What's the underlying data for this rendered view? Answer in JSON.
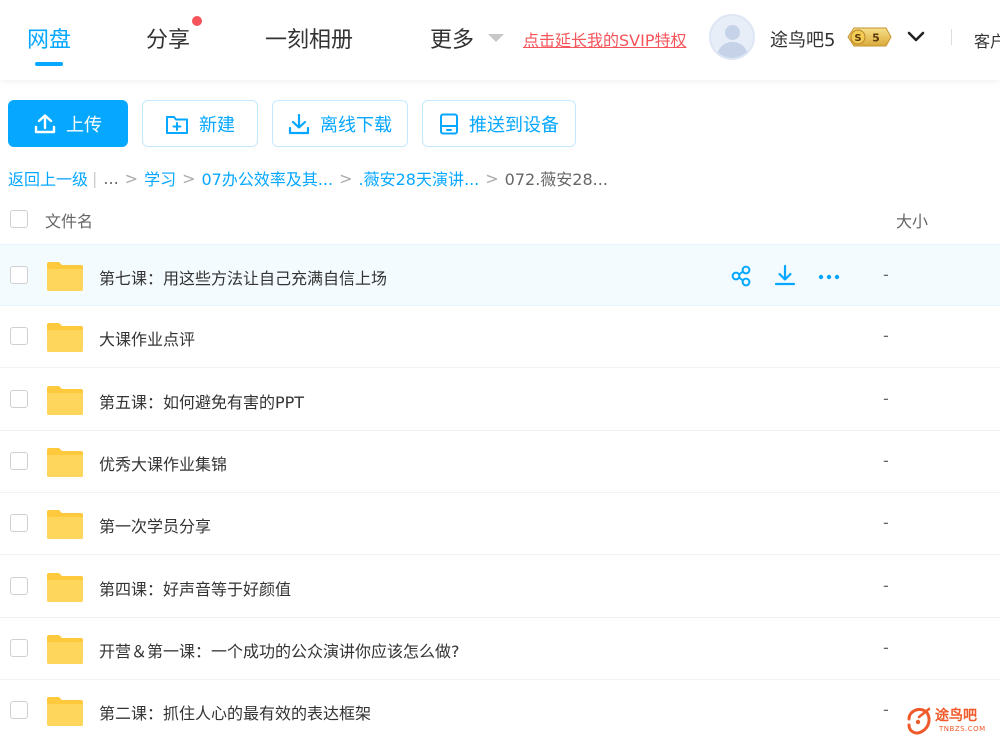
{
  "nav": {
    "tabs": [
      {
        "label": "网盘",
        "active": true
      },
      {
        "label": "分享",
        "has_dot": true
      },
      {
        "label": "一刻相册"
      },
      {
        "label": "更多"
      }
    ],
    "svip_link": "点击延长我的SVIP特权",
    "username": "途鸟吧5",
    "vip_level": "5",
    "client_label": "客户"
  },
  "toolbar": {
    "upload": "上传",
    "new": "新建",
    "offline_download": "离线下载",
    "push_to_device": "推送到设备"
  },
  "breadcrumb": {
    "back": "返回上一级",
    "ellipsis": "...",
    "items": [
      "学习",
      "07办公效率及其...",
      ".薇安28天演讲..."
    ],
    "current": "072.薇安28..."
  },
  "table": {
    "col_name": "文件名",
    "col_size": "大小",
    "rows": [
      {
        "name": "第七课：用这些方法让自己充满自信上场",
        "size": "-"
      },
      {
        "name": "大课作业点评",
        "size": "-"
      },
      {
        "name": "第五课：如何避免有害的PPT",
        "size": "-"
      },
      {
        "name": "优秀大课作业集锦",
        "size": "-"
      },
      {
        "name": "第一次学员分享",
        "size": "-"
      },
      {
        "name": "第四课：好声音等于好颜值",
        "size": "-"
      },
      {
        "name": "开营＆第一课：一个成功的公众演讲你应该怎么做?",
        "size": "-"
      },
      {
        "name": "第二课：抓住人心的最有效的表达框架",
        "size": "-"
      }
    ]
  },
  "watermark": {
    "text": "途鸟吧",
    "sub": "TNBZS.COM"
  },
  "colors": {
    "accent": "#06a7ff",
    "alert": "#f4545a",
    "folder": "#ffd65c"
  }
}
